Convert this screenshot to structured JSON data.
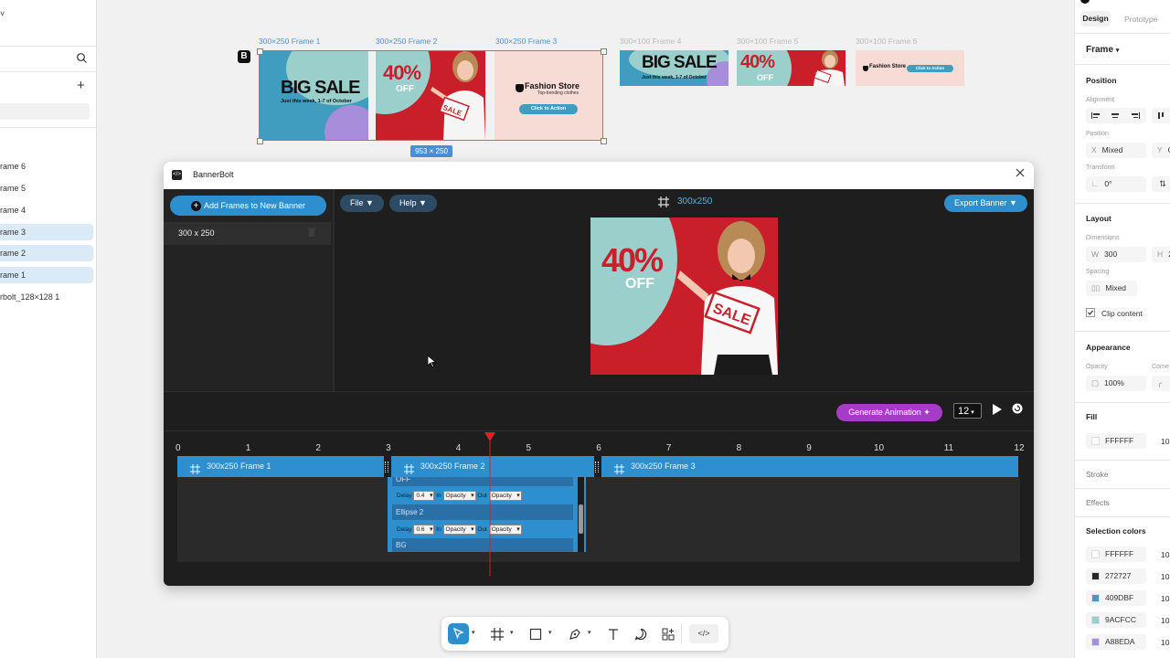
{
  "left_panel": {
    "layers": [
      {
        "label": "rame 6",
        "selected": false
      },
      {
        "label": "rame 5",
        "selected": false
      },
      {
        "label": "rame 4",
        "selected": false
      },
      {
        "label": "rame 3",
        "selected": true
      },
      {
        "label": "rame 2",
        "selected": true
      },
      {
        "label": "rame 1",
        "selected": true
      },
      {
        "label": "rbolt_128×128 1",
        "selected": false
      }
    ]
  },
  "canvas": {
    "logo_letter": "B",
    "selection_size": "953 × 250",
    "frames": [
      {
        "label": "300×250 Frame 1"
      },
      {
        "label": "300×250 Frame 2"
      },
      {
        "label": "300×250 Frame 3"
      },
      {
        "label": "300×100 Frame 4"
      },
      {
        "label": "300×100 Frame 5"
      },
      {
        "label": "300×100 Frame 6"
      }
    ],
    "banner": {
      "big_sale": "BIG SALE",
      "big_sale_sub": "Just this week, 1-7 of October",
      "percent": "40%",
      "off": "OFF",
      "sale_tag": "SALE",
      "store_name": "Fashion Store",
      "store_tagline": "Top-trending clothes",
      "cta": "Click to Action"
    }
  },
  "plugin": {
    "title": "BannerBolt",
    "add_frames_button": "Add Frames to New Banner",
    "banner_list": [
      {
        "label": "300 x 250"
      }
    ],
    "menu_file": "File ▼",
    "menu_help": "Help ▼",
    "preview_size": "300x250",
    "export_button": "Export Banner ▼",
    "generate_button": "Generate Animation",
    "fps_value": "12",
    "timeline": {
      "ticks": [
        "0",
        "1",
        "2",
        "3",
        "4",
        "5",
        "6",
        "7",
        "8",
        "9",
        "10",
        "11",
        "12"
      ],
      "playhead_at": 4.45,
      "tracks": [
        {
          "label": "300x250 Frame 1",
          "start": 0,
          "end": 2.95
        },
        {
          "label": "300x250 Frame 2",
          "start": 3.05,
          "end": 5.95
        },
        {
          "label": "300x250 Frame 3",
          "start": 6.05,
          "end": 12
        }
      ],
      "layers": [
        {
          "name": "OFF"
        },
        {
          "name": "Ellipse 2",
          "delay": "0.6",
          "in": "Opacity",
          "out": "Opacity"
        },
        {
          "name": "BG"
        }
      ],
      "row_a": {
        "delay": "0.4",
        "in": "Opacity",
        "out": "Opacity"
      },
      "labels": {
        "delay": "Delay",
        "in": "In",
        "out": "Out"
      }
    }
  },
  "right_panel": {
    "tabs": [
      "Design",
      "Prototype"
    ],
    "frame_label": "Frame",
    "position_title": "Position",
    "alignment_label": "Alignment",
    "position_label": "Position",
    "x_label": "X",
    "x_value": "Mixed",
    "y_label": "Y",
    "y_value": "C",
    "transform_label": "Transform",
    "rotation_value": "0°",
    "layout_title": "Layout",
    "dimensions_label": "Dimensions",
    "w_label": "W",
    "w_value": "300",
    "h_label": "H",
    "h_value": "2",
    "spacing_label": "Spacing",
    "spacing_value": "Mixed",
    "clip_label": "Clip content",
    "appearance_title": "Appearance",
    "opacity_label": "Opacity",
    "corner_label": "Corne",
    "opacity_value": "100%",
    "fill_title": "Fill",
    "fill_hex": "FFFFFF",
    "fill_pct": "10",
    "stroke_title": "Stroke",
    "effects_title": "Effects",
    "selection_colors_title": "Selection colors",
    "selection_colors": [
      {
        "hex": "FFFFFF",
        "color": "#FFFFFF",
        "pct": "10"
      },
      {
        "hex": "272727",
        "color": "#272727",
        "pct": "10"
      },
      {
        "hex": "409DBF",
        "color": "#409DBF",
        "pct": "10"
      },
      {
        "hex": "9ACFCC",
        "color": "#9ACFCC",
        "pct": "10"
      },
      {
        "hex": "A88EDA",
        "color": "#A88EDA",
        "pct": "10"
      }
    ]
  },
  "colors": {
    "accent_blue": "#2d8fce",
    "selection_blue": "#4a90d9",
    "generate_purple": "#a63bc7",
    "playhead_red": "#e02020",
    "banner_red": "#c91f2b",
    "banner_teal": "#9acfcc",
    "banner_blue": "#409dbf",
    "banner_pink": "#f6dcd4"
  }
}
